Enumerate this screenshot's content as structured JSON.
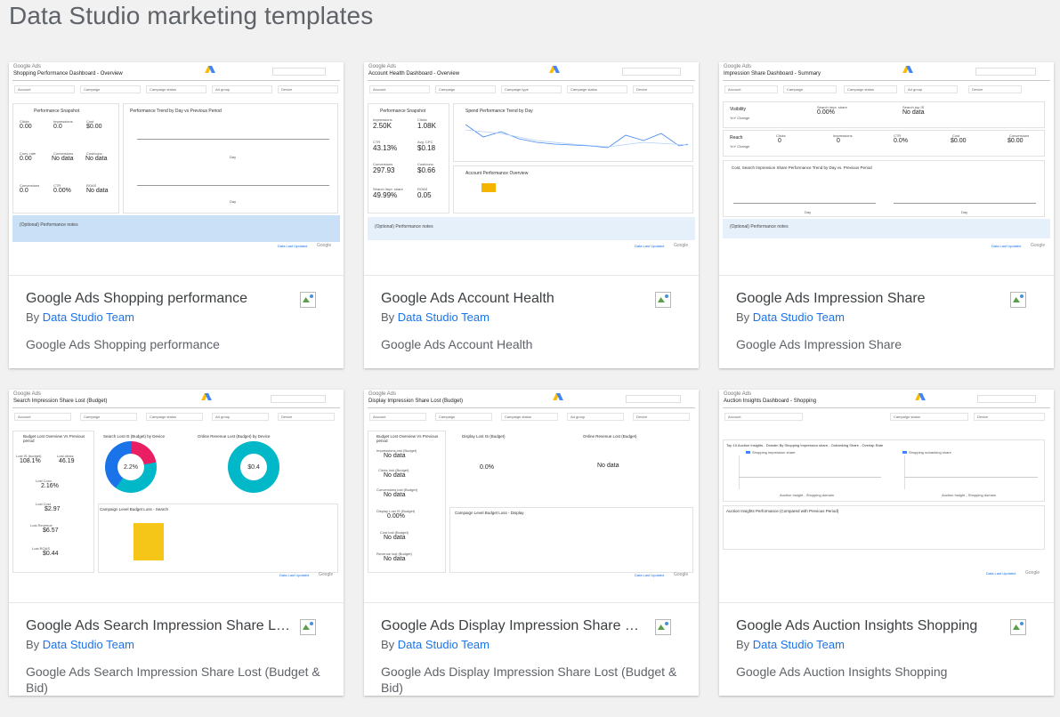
{
  "page": {
    "title": "Data Studio marketing templates"
  },
  "author_prefix": "By",
  "cards": [
    {
      "title": "Google Ads Shopping performance",
      "author": "Data Studio Team",
      "description": "Google Ads Shopping performance",
      "thumb": {
        "logo": "Google Ads",
        "title": "Shopping Performance Dashboard - Overview",
        "filters": [
          "Account",
          "Campaign",
          "Campaign status",
          "Ad group",
          "Device"
        ],
        "section1": "Performance Snapshot",
        "section2": "Performance Trend by Day vs Previous Period",
        "metrics": [
          {
            "label": "Clicks",
            "value": "0.00"
          },
          {
            "label": "Impressions",
            "value": "0.0"
          },
          {
            "label": "Cost",
            "value": "$0.00"
          },
          {
            "label": "Conv. rate",
            "value": "0.00"
          },
          {
            "label": "Conversions",
            "value": "No data"
          },
          {
            "label": "Cost/conv.",
            "value": "No data"
          },
          {
            "label": "Conversions",
            "value": "0.0"
          },
          {
            "label": "CTR",
            "value": "0.00%"
          },
          {
            "label": "ROAS",
            "value": "No data"
          }
        ],
        "note": "(Optional) Performance notes",
        "axis": "Day",
        "footer_link": "Data Last Updated",
        "footer_brand": "Google"
      }
    },
    {
      "title": "Google Ads Account Health",
      "author": "Data Studio Team",
      "description": "Google Ads Account Health",
      "thumb": {
        "logo": "Google Ads",
        "title": "Account Health Dashboard - Overview",
        "filters": [
          "Account",
          "Campaign",
          "Campaign type",
          "Campaign status",
          "Device"
        ],
        "section1": "Performance Snapshot",
        "section2": "Spend Performance Trend by Day",
        "section3": "Account Performance Overview",
        "metrics": [
          {
            "label": "Impressions",
            "value": "2.50K"
          },
          {
            "label": "Clicks",
            "value": "1.08K"
          },
          {
            "label": "CTR",
            "value": "43.13%"
          },
          {
            "label": "Avg. CPC",
            "value": "$0.18"
          },
          {
            "label": "Conversions",
            "value": "297.93"
          },
          {
            "label": "Cost/conv.",
            "value": "$0.66"
          },
          {
            "label": "Search Impr. share",
            "value": "49.99%"
          },
          {
            "label": "ROAS",
            "value": "0.05"
          }
        ],
        "note": "(Optional) Performance notes",
        "footer_link": "Data Last Updated",
        "footer_brand": "Google"
      }
    },
    {
      "title": "Google Ads Impression Share",
      "author": "Data Studio Team",
      "description": "Google Ads Impression Share",
      "thumb": {
        "logo": "Google Ads",
        "title": "Impression Share Dashboard - Summary",
        "filters": [
          "Account",
          "Campaign",
          "Campaign status",
          "Ad group",
          "Device"
        ],
        "row1_label": "Visibility",
        "row1_sub": "YoY Change",
        "row2_label": "Reach",
        "row2_sub": "YoY Change",
        "metrics": [
          {
            "label": "Search Impr. share",
            "value": "0.00%"
          },
          {
            "label": "Search top IS",
            "value": "No data"
          },
          {
            "label": "Clicks",
            "value": "0"
          },
          {
            "label": "Impressions",
            "value": "0"
          },
          {
            "label": "CTR",
            "value": "0.0%"
          },
          {
            "label": "Cost",
            "value": "$0.00"
          },
          {
            "label": "Conversions",
            "value": "$0.00"
          }
        ],
        "section2": "Cost, Search Impression Share Performance Trend by Day vs. Previous Period",
        "note": "(Optional) Performance notes",
        "axis": "Day",
        "footer_link": "Data Last Updated",
        "footer_brand": "Google"
      }
    },
    {
      "title": "Google Ads Search Impression Share Lost (Budget & Bid)",
      "author": "Data Studio Team",
      "description": "Google Ads Search Impression Share Lost (Budget & Bid)",
      "thumb": {
        "logo": "Google Ads",
        "title": "Search Impression Share Lost (Budget)",
        "filters": [
          "Account",
          "Campaign",
          "Campaign status",
          "Ad group",
          "Device"
        ],
        "section1": "Budget Lost Overview Vs Previous period",
        "section2": "Search Lost IS (Budget) by Device",
        "section3": "Online Revenue Lost (Budget) by Device",
        "section4": "Campaign Level Budget Loss - Search",
        "metrics": [
          {
            "label": "Lost IS (budget)",
            "value": "108.1%"
          },
          {
            "label": "Lost clicks",
            "value": "46.19"
          },
          {
            "label": "Lost Conv.",
            "value": "2.16%"
          },
          {
            "label": "Lost Cost",
            "value": "$2.97"
          },
          {
            "label": "Lost Revenue",
            "value": "$6.57"
          },
          {
            "label": "Lost ROAS",
            "value": "$0.44"
          }
        ],
        "donut1_value": "2.2%",
        "donut2_value": "$0.4",
        "footer_link": "Data Last Updated",
        "footer_brand": "Google"
      }
    },
    {
      "title": "Google Ads Display Impression Share Lost (Budget & Bid)",
      "author": "Data Studio Team",
      "description": "Google Ads Display Impression Share Lost (Budget & Bid)",
      "thumb": {
        "logo": "Google Ads",
        "title": "Display Impression Share Lost (Budget)",
        "filters": [
          "Account",
          "Campaign",
          "Campaign status",
          "Ad group",
          "Device"
        ],
        "section1": "Budget Lost Overview Vs Previous period",
        "section2": "Display Lost IS (Budget)",
        "section3": "Online Revenue Lost (Budget)",
        "section4": "Campaign Level Budget Loss - Display",
        "metrics": [
          {
            "label": "Impressions lost (Budget)",
            "value": "No data"
          },
          {
            "label": "Clicks lost (Budget)",
            "value": "No data"
          },
          {
            "label": "Conversions lost (Budget)",
            "value": "No data"
          },
          {
            "label": "Display Lost IS (Budget)",
            "value": "0.00%"
          },
          {
            "label": "Cost lost (Budget)",
            "value": "No data"
          },
          {
            "label": "Revenue lost (Budget)",
            "value": "No data"
          }
        ],
        "mid_value1": "0.0%",
        "mid_value2": "No data",
        "footer_link": "Data Last Updated",
        "footer_brand": "Google"
      }
    },
    {
      "title": "Google Ads Auction Insights Shopping",
      "author": "Data Studio Team",
      "description": "Google Ads Auction Insights Shopping",
      "thumb": {
        "logo": "Google Ads",
        "title": "Auction Insights Dashboard - Shopping",
        "filters": [
          "Account",
          "Campaign status",
          "Device"
        ],
        "section1": "Top 10 Auction Insights - Domain By Shopping Impression share - Outranking Share - Overlap Rate",
        "section2": "Auction Insights Performance (Compared with Previous Period)",
        "legend1": "Shopping impression share",
        "legend2": "Shopping outranking share",
        "axis1": "Auction Insight - Shopping domain",
        "axis2": "Auction Insight - Shopping domain",
        "footer_link": "Data Last Updated",
        "footer_brand": "Google"
      }
    }
  ]
}
